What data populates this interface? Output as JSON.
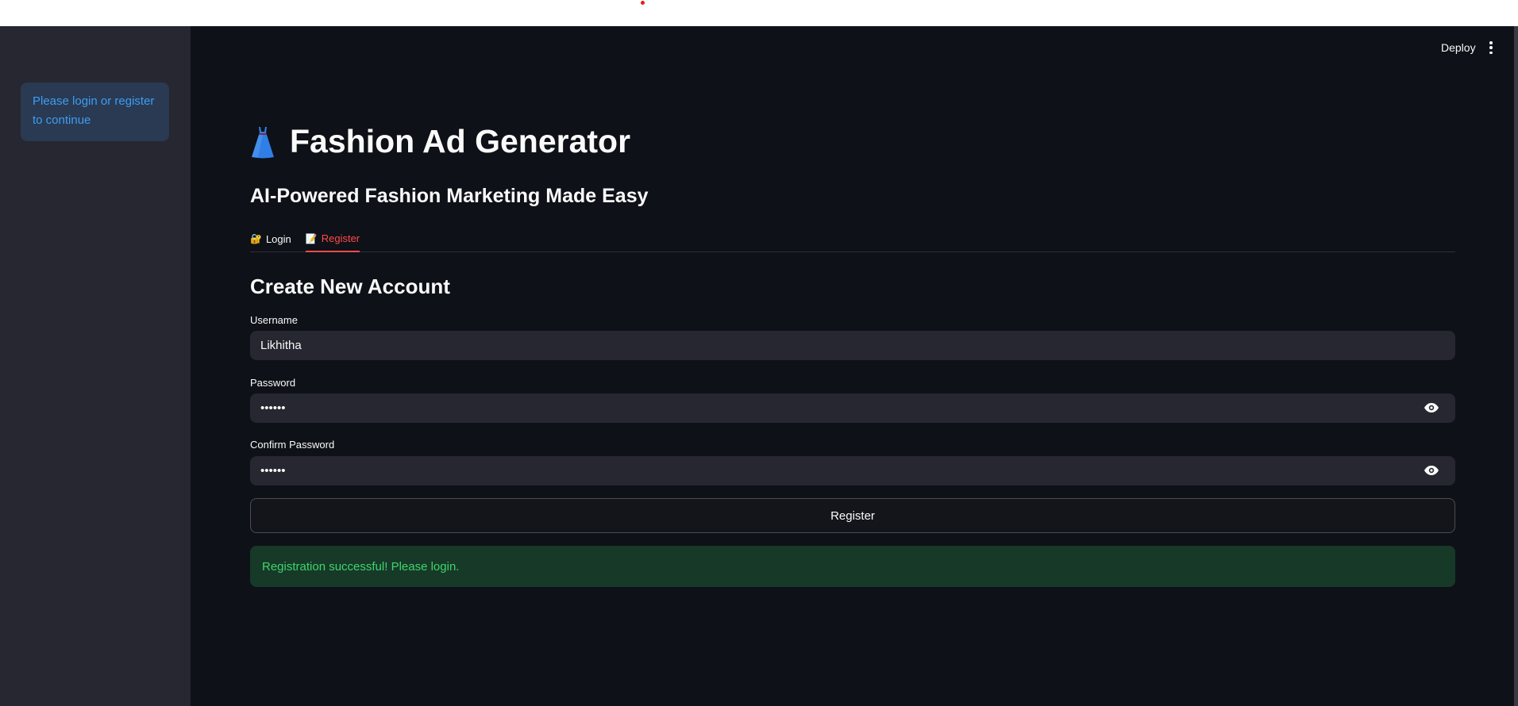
{
  "sidebar": {
    "info_message": "Please login or register to continue"
  },
  "header": {
    "deploy_label": "Deploy",
    "menu_icon": "vertical-dots-icon"
  },
  "main": {
    "title_icon": "dress-icon",
    "title": "Fashion Ad Generator",
    "subtitle": "AI-Powered Fashion Marketing Made Easy",
    "tabs": [
      {
        "label": "Login",
        "icon": "🔐",
        "active": false
      },
      {
        "label": "Register",
        "icon": "📝",
        "active": true
      }
    ],
    "form": {
      "heading": "Create New Account",
      "username_label": "Username",
      "username_value": "Likhitha",
      "password_label": "Password",
      "password_value": "••••••",
      "confirm_label": "Confirm Password",
      "confirm_value": "••••••",
      "submit_label": "Register"
    },
    "success_message": "Registration successful! Please login."
  },
  "colors": {
    "accent": "#ff4b4b",
    "info_text": "#3d9df3",
    "success_text": "#3dd56d",
    "background": "#0e1117",
    "sidebar": "#262730"
  }
}
